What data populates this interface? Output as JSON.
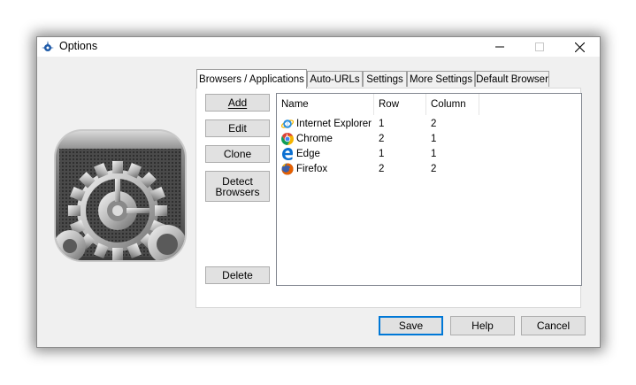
{
  "window": {
    "title": "Options"
  },
  "caption": {
    "minimize": "—",
    "maximize": "☐",
    "close": "✕"
  },
  "tabs": [
    {
      "label": "Browsers / Applications",
      "active": true
    },
    {
      "label": "Auto-URLs"
    },
    {
      "label": "Settings"
    },
    {
      "label": "More Settings"
    },
    {
      "label": "Default Browser"
    }
  ],
  "side_buttons": {
    "add": "Add",
    "edit": "Edit",
    "clone": "Clone",
    "detect_line1": "Detect",
    "detect_line2": "Browsers",
    "delete": "Delete"
  },
  "listview": {
    "columns": [
      "Name",
      "Row",
      "Column"
    ],
    "rows": [
      {
        "name": "Internet Explorer",
        "row": "1",
        "column": "2",
        "icon": "internet-explorer-icon"
      },
      {
        "name": "Chrome",
        "row": "2",
        "column": "1",
        "icon": "chrome-icon"
      },
      {
        "name": "Edge",
        "row": "1",
        "column": "1",
        "icon": "edge-icon"
      },
      {
        "name": "Firefox",
        "row": "2",
        "column": "2",
        "icon": "firefox-icon"
      }
    ]
  },
  "dialog_buttons": {
    "save": "Save",
    "help": "Help",
    "cancel": "Cancel"
  },
  "colors": {
    "accent": "#0078d7",
    "window_bg": "#f0f0f0",
    "panel_bg": "#ffffff"
  }
}
